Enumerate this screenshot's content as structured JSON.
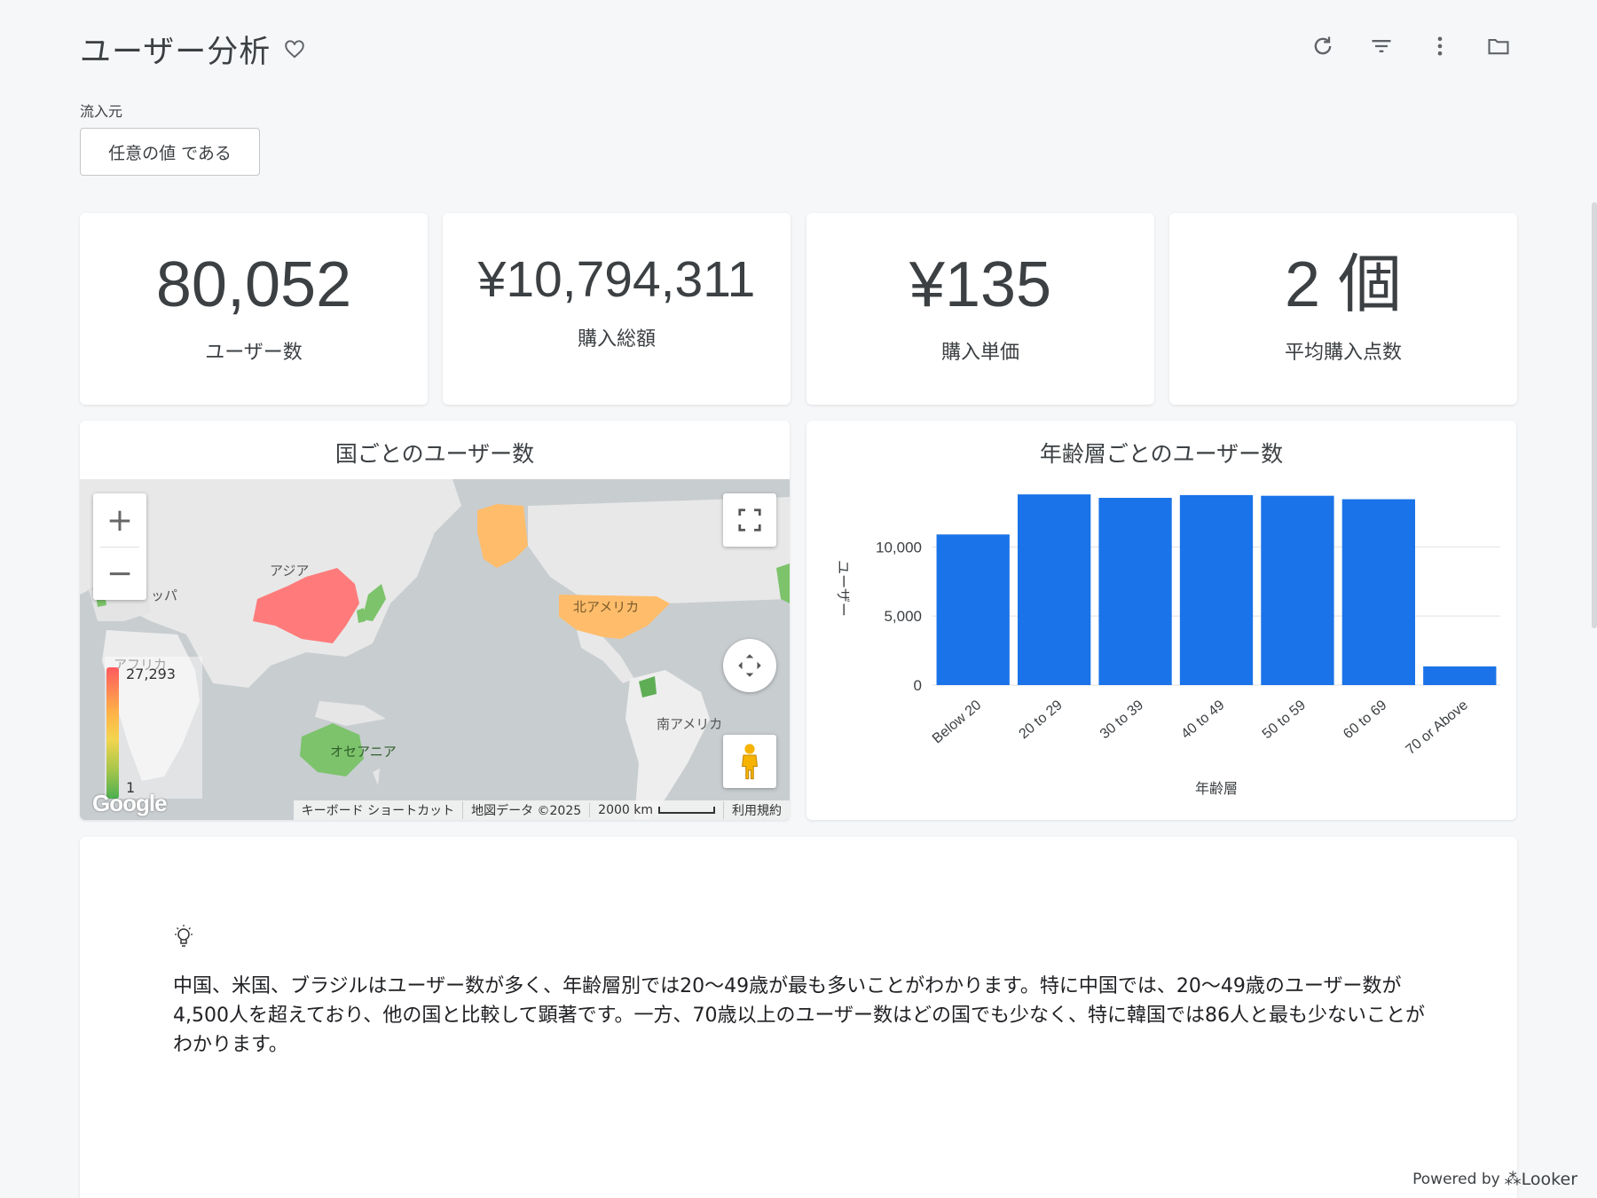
{
  "header": {
    "title": "ユーザー分析"
  },
  "toolbar": {
    "icons": [
      "refresh-icon",
      "filter-icon",
      "more-vert-icon",
      "folder-icon"
    ]
  },
  "filter": {
    "label": "流入元",
    "value": "任意の値 である"
  },
  "kpis": [
    {
      "value": "80,052",
      "label": "ユーザー数"
    },
    {
      "value": "¥10,794,311",
      "label": "購入総額"
    },
    {
      "value": "¥135",
      "label": "購入単価"
    },
    {
      "value": "2 個",
      "label": "平均購入点数"
    }
  ],
  "map": {
    "title": "国ごとのユーザー数",
    "region_labels": {
      "asia": "アジア",
      "europe": "ッパ",
      "north_america": "北アメリカ",
      "south_america": "南アメリカ",
      "africa": "アフリカ",
      "oceania": "オセアニア"
    },
    "legend": {
      "max": "27,293",
      "min": "1"
    },
    "footer": {
      "shortcuts": "キーボード ショートカット",
      "map_data": "地図データ ©2025",
      "scale": "2000 km",
      "terms": "利用規約"
    },
    "logo": "Google"
  },
  "chart_data": {
    "type": "bar",
    "title": "年齢層ごとのユーザー数",
    "xlabel": "年齢層",
    "ylabel": "ユーザー",
    "categories": [
      "Below 20",
      "20 to 29",
      "30 to 39",
      "40 to 49",
      "50 to 59",
      "60 to 69",
      "70 or Above"
    ],
    "values": [
      10900,
      13800,
      13550,
      13750,
      13700,
      13450,
      1350
    ],
    "ylim": [
      0,
      14000
    ],
    "yticks": [
      0,
      5000,
      10000
    ],
    "ytick_labels": [
      "0",
      "5,000",
      "10,000"
    ],
    "grid": true,
    "color": "#1a73e8"
  },
  "insight": {
    "text": "中国、米国、ブラジルはユーザー数が多く、年齢層別では20〜49歳が最も多いことがわかります。特に中国では、20〜49歳のユーザー数が4,500人を超えており、他の国と比較して顕著です。一方、70歳以上のユーザー数はどの国でも少なく、特に韓国では86人と最も少ないことがわかります。"
  },
  "footer": {
    "powered_by": "Powered by",
    "brand": "Looker"
  }
}
